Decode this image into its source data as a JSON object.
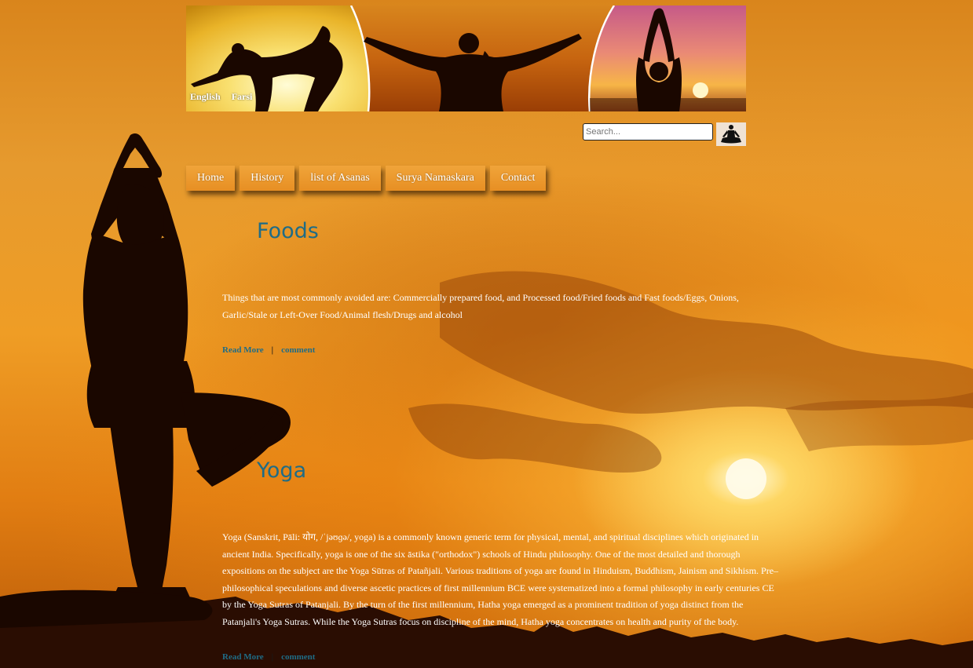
{
  "header": {
    "languages": [
      "English",
      "Farsi"
    ]
  },
  "search": {
    "placeholder": "Search..."
  },
  "nav": {
    "items": [
      "Home",
      "History",
      "list of Asanas",
      "Surya Namaskara",
      "Contact"
    ]
  },
  "posts": [
    {
      "title": "Foods",
      "body": "Things that are most commonly avoided are: Commercially prepared food, and Processed food/Fried foods and Fast foods/Eggs, Onions, Garlic/Stale or Left-Over Food/Animal flesh/Drugs and alcohol",
      "read_more": "Read More",
      "separator": "|",
      "comment": "comment"
    },
    {
      "title": "Yoga",
      "body": "Yoga (Sanskrit, Pāli: योग, /ˈjəʊɡə/, yoga) is a commonly known generic term for physical, mental, and spiritual disciplines which originated in ancient India. Specifically, yoga is one of the six āstika (\"orthodox\") schools of Hindu philosophy. One of the most detailed and thorough expositions on the subject are the Yoga Sūtras of Patañjali. Various traditions of yoga are found in Hinduism, Buddhism, Jainism and Sikhism. Pre–philosophical speculations and diverse ascetic practices of first millennium BCE were systematized into a formal philosophy in early centuries CE by the Yoga Sutras of Patanjali. By the turn of the first millennium, Hatha yoga emerged as a prominent tradition of yoga distinct from the Patanjali's Yoga Sutras. While the Yoga Sutras focus on discipline of the mind, Hatha yoga concentrates on health and purity of the body.",
      "read_more": "Read More",
      "separator": "|",
      "comment": "comment"
    }
  ],
  "colors": {
    "title": "#1f6c86",
    "link": "#1f6c86",
    "nav_bg": "#e99528",
    "body_text": "#ffffff"
  },
  "icons": {
    "search_button": "meditating-figure-icon"
  }
}
